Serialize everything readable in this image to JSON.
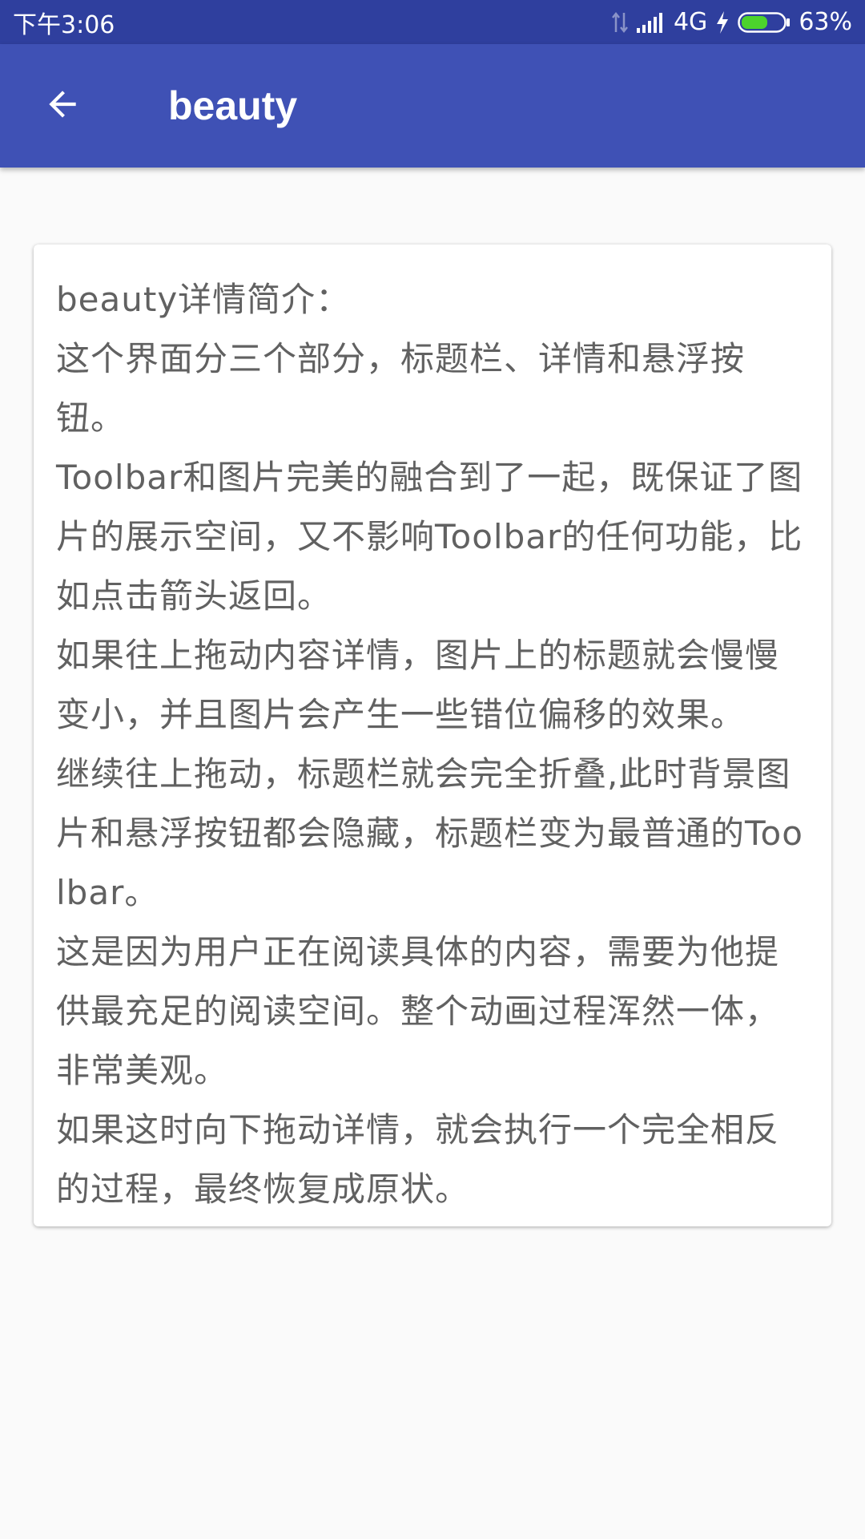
{
  "status_bar": {
    "time": "下午3:06",
    "network": "4G",
    "battery": "63%",
    "battery_level": 0.63,
    "icons": [
      "data-transfer-icon",
      "signal-icon",
      "charging-icon",
      "battery-icon"
    ]
  },
  "toolbar": {
    "title": "beauty",
    "back_icon": "arrow-back-icon",
    "background_color": "#3f51b5"
  },
  "detail": {
    "text": "beauty详情简介：\n这个界面分三个部分，标题栏、详情和悬浮按钮。\nToolbar和图片完美的融合到了一起，既保证了图片的展示空间，又不影响Toolbar的任何功能，比如点击箭头返回。\n如果往上拖动内容详情，图片上的标题就会慢慢变小，并且图片会产生一些错位偏移的效果。\n继续往上拖动，标题栏就会完全折叠,此时背景图片和悬浮按钮都会隐藏，标题栏变为最普通的Toolbar。\n这是因为用户正在阅读具体的内容，需要为他提供最充足的阅读空间。整个动画过程浑然一体，非常美观。\n如果这时向下拖动详情，就会执行一个完全相反的过程，最终恢复成原状。"
  }
}
